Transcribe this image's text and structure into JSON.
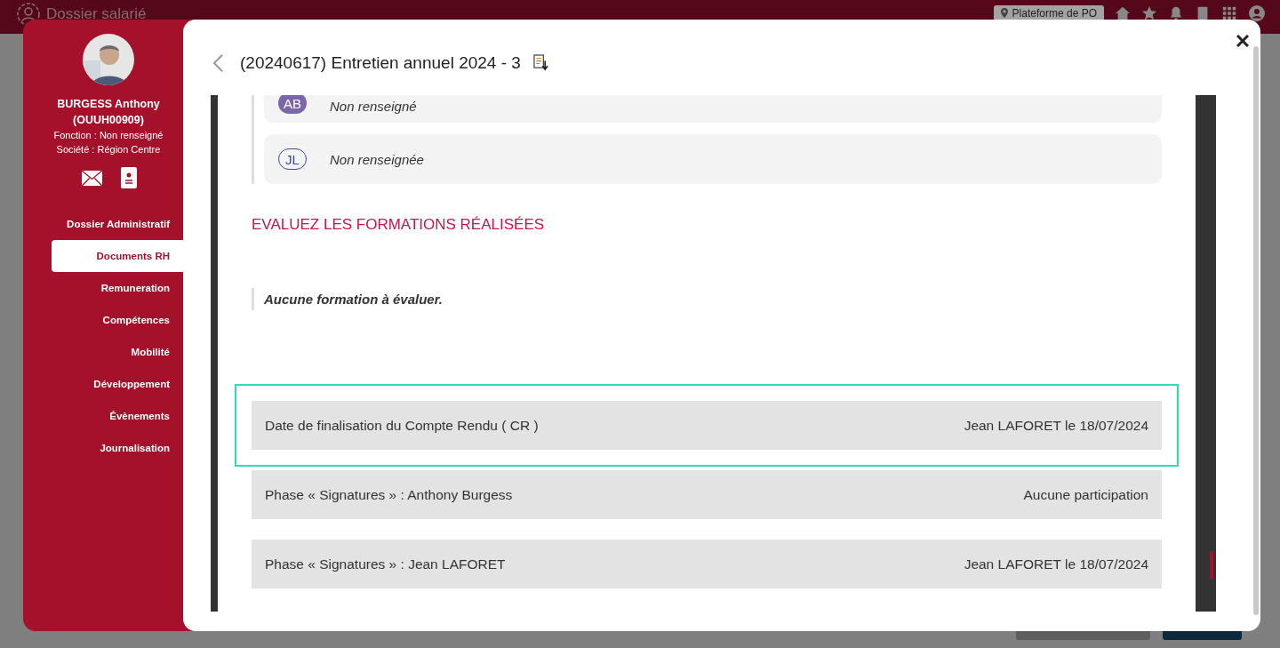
{
  "app_header": {
    "title": "Dossier salarié",
    "location": "Plateforme de PO"
  },
  "profile": {
    "name": "BURGESS Anthony",
    "code": "(OUUH00909)",
    "fonction": "Fonction : Non renseigné",
    "societe": "Société : Région Centre"
  },
  "nav": [
    {
      "label": "Dossier Administratif",
      "selected": false
    },
    {
      "label": "Documents RH",
      "selected": true
    },
    {
      "label": "Remuneration",
      "selected": false
    },
    {
      "label": "Compétences",
      "selected": false
    },
    {
      "label": "Mobilité",
      "selected": false
    },
    {
      "label": "Développement",
      "selected": false
    },
    {
      "label": "Évènements",
      "selected": false
    },
    {
      "label": "Journalisation",
      "selected": false
    }
  ],
  "dialog": {
    "title": "(20240617) Entretien annuel 2024 - 3"
  },
  "participants": [
    {
      "initials": "AB",
      "filled": true,
      "value": "Non renseigné"
    },
    {
      "initials": "JL",
      "filled": false,
      "value": "Non renseignée"
    }
  ],
  "section_title": "EVALUEZ LES FORMATIONS RÉALISÉES",
  "empty_message": "Aucune formation à évaluer.",
  "phases": [
    {
      "label": "Date de finalisation du Compte Rendu ( CR )",
      "value": "Jean LAFORET le 18/07/2024",
      "highlighted": true
    },
    {
      "label": "Phase « Signatures » : Anthony Burgess",
      "value": "Aucune participation",
      "highlighted": false
    },
    {
      "label": "Phase « Signatures » : Jean LAFORET",
      "value": "Jean LAFORET le 18/07/2024",
      "highlighted": false
    }
  ]
}
